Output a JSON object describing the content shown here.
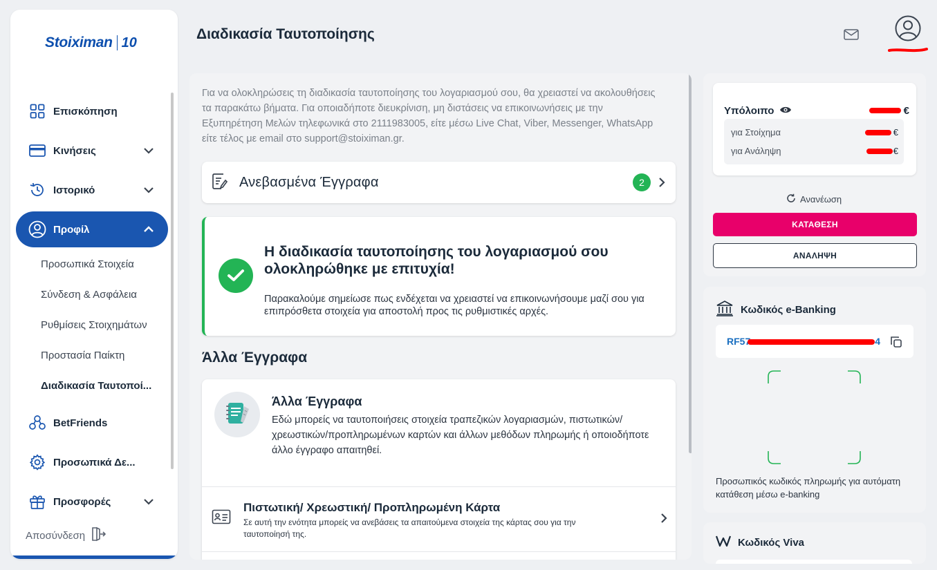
{
  "brand": {
    "name": "Stoiximan",
    "anniversary": "10"
  },
  "sidebar": {
    "items": [
      {
        "label": "Επισκόπηση",
        "icon": "grid-icon"
      },
      {
        "label": "Κινήσεις",
        "icon": "card-icon"
      },
      {
        "label": "Ιστορικό",
        "icon": "history-icon"
      },
      {
        "label": "Προφίλ",
        "icon": "user-circle-icon",
        "active": true
      },
      {
        "label": "BetFriends",
        "icon": "friends-icon"
      },
      {
        "label": "Προσωπικά Δε...",
        "icon": "gear-icon"
      },
      {
        "label": "Προσφορές",
        "icon": "gift-icon"
      }
    ],
    "profile_subitems": [
      "Προσωπικά Στοιχεία",
      "Σύνδεση & Ασφάλεια",
      "Ρυθμίσεις Στοιχημάτων",
      "Προστασία Παίκτη",
      "Διαδικασία Ταυτοποί..."
    ],
    "logout": "Αποσύνδεση"
  },
  "header": {
    "title": "Διαδικασία Ταυτοποίησης"
  },
  "main": {
    "intro": "Για να ολοκληρώσεις τη διαδικασία ταυτοποίησης του λογαριασμού σου, θα χρειαστεί να ακολουθήσεις τα παρακάτω βήματα. Για οποιαδήποτε διευκρίνιση, μη διστάσεις να επικοινωνήσεις με την Εξυπηρέτηση Μελών τηλεφωνικά στο 2111983005, είτε μέσω Live Chat, Viber, Messenger, WhatsApp είτε τέλος με email στο support@stoiximan.gr.",
    "uploaded": {
      "title": "Ανεβασμένα Έγγραφα",
      "count": "2"
    },
    "success": {
      "title": "Η διαδικασία ταυτοποίησης του λογαριασμού σου ολοκληρώθηκε με επιτυχία!",
      "text": "Παρακαλούμε σημείωσε πως ενδέχεται να χρειαστεί να επικοινωνήσουμε μαζί σου για επιπρόσθετα στοιχεία για αποστολή προς τις ρυθμιστικές αρχές."
    },
    "other_section_title": "Άλλα Έγγραφα",
    "other": {
      "title": "Άλλα Έγγραφα",
      "text": "Εδώ μπορείς να ταυτοποιήσεις στοιχεία τραπεζικών λογαριασμών, πιστωτικών/χρεωστικών/προπληρωμένων καρτών και άλλων μεθόδων πληρωμής ή οποιοδήποτε άλλο έγγραφο απαιτηθεί.",
      "card_row": {
        "title": "Πιστωτική/ Χρεωστική/ Προπληρωμένη Κάρτα",
        "text": "Σε αυτή την ενότητα μπορείς να ανεβάσεις τα απαιτούμενα στοιχεία της κάρτας σου για την ταυτοποίησή της."
      }
    }
  },
  "balance": {
    "label": "Υπόλοιπο",
    "currency": "€",
    "bet_label": "για Στοίχημα",
    "withdraw_label": "για Ανάληψη",
    "refresh": "Ανανέωση",
    "deposit": "ΚΑΤΑΘΕΣΗ",
    "withdraw": "ΑΝΑΛΗΨΗ"
  },
  "ebanking": {
    "title": "Κωδικός e-Banking",
    "code_prefix": "RF57",
    "code_suffix": "4",
    "description": "Προσωπικός κωδικός πληρωμής για αυτόματη κατάθεση μέσω e-banking"
  },
  "viva": {
    "title": "Κωδικός Viva"
  },
  "colors": {
    "primary": "#1a56b0",
    "success": "#23b455",
    "deposit": "#e8006a",
    "redaction": "#ff0000"
  }
}
